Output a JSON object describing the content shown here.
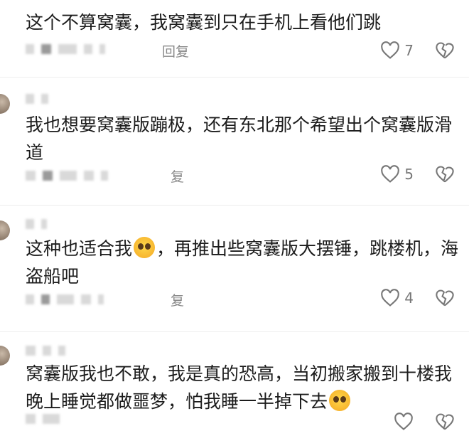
{
  "comments": [
    {
      "text": "这个不算窝囊，我窝囊到只在手机上看他们跳",
      "reply": "回复",
      "likes": "7",
      "meta_name": ""
    },
    {
      "text": "我也想要窝囊版蹦极，还有东北那个希望出个窝囊版滑道",
      "reply": "复",
      "likes": "5",
      "meta_name": ""
    },
    {
      "text_a": "这种也适合我",
      "text_b": "，再推出些窝囊版大摆锤，跳楼机，海盗船吧",
      "reply": "复",
      "likes": "4"
    },
    {
      "text_a": "窝囊版我也不敢，我是真的恐高，当初搬家搬到十楼我晚上睡觉都做噩梦，怕我睡一半掉下去",
      "reply": "",
      "likes": ""
    }
  ],
  "colors": {
    "icon": "#777777",
    "text": "#1c1c1c",
    "muted": "#8a8a8a"
  }
}
